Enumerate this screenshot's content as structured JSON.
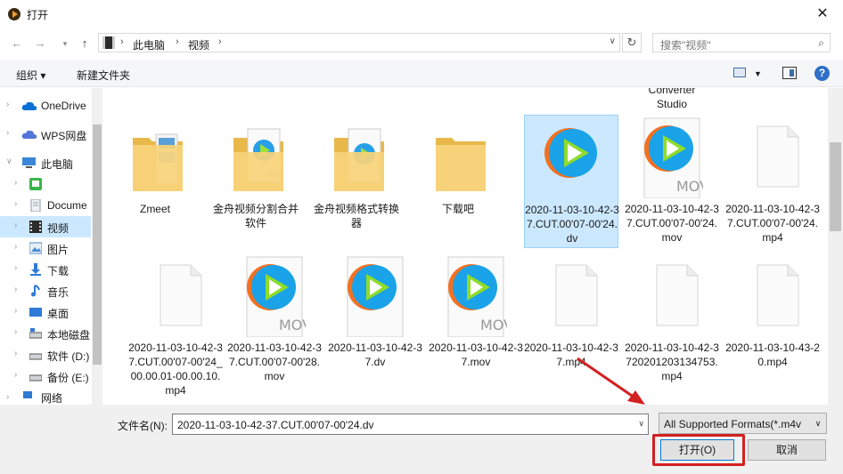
{
  "window": {
    "title": "打开",
    "close_glyph": "✕"
  },
  "address": {
    "crumbs": [
      "此电脑",
      "视频"
    ],
    "search_placeholder": "搜索\"视频\""
  },
  "toolbar": {
    "organize_label": "组织 ▾",
    "new_folder_label": "新建文件夹"
  },
  "sidebar": {
    "items": [
      {
        "label": "OneDrive",
        "icon": "cloud-icon",
        "color": "#0a6fd4"
      },
      {
        "label": "WPS网盘",
        "icon": "cloud-icon",
        "color": "#5277d8"
      },
      {
        "label": "此电脑",
        "icon": "computer-icon",
        "color": "#3b87d6"
      },
      {
        "label": "",
        "icon": "app-icon",
        "color": "#3bb54a"
      },
      {
        "label": "Docume",
        "icon": "document-icon",
        "color": "#8e9aa8"
      },
      {
        "label": "视频",
        "icon": "video-icon",
        "color": "#2b2b2b"
      },
      {
        "label": "图片",
        "icon": "picture-icon",
        "color": "#4a8bd0"
      },
      {
        "label": "下载",
        "icon": "download-icon",
        "color": "#2d7ad6"
      },
      {
        "label": "音乐",
        "icon": "music-icon",
        "color": "#2d7ad6"
      },
      {
        "label": "桌面",
        "icon": "desktop-icon",
        "color": "#2d7ad6"
      },
      {
        "label": "本地磁盘",
        "icon": "drive-icon",
        "color": "#555555"
      },
      {
        "label": "软件 (D:)",
        "icon": "drive-icon",
        "color": "#555555"
      },
      {
        "label": "备份 (E:)",
        "icon": "drive-icon",
        "color": "#555555"
      },
      {
        "label": "网络",
        "icon": "network-icon",
        "color": "#2d7ad6"
      }
    ]
  },
  "files": {
    "partial_label": "Converter Studio",
    "items": [
      {
        "label": "Zmeet",
        "kind": "folder"
      },
      {
        "label": "金舟视频分割合并软件",
        "kind": "folder-mp4"
      },
      {
        "label": "金舟视频格式转换器",
        "kind": "folder-video"
      },
      {
        "label": "下载吧",
        "kind": "folder"
      },
      {
        "label": "2020-11-03-10-42-37.CUT.00'07-00'24.dv",
        "kind": "video"
      },
      {
        "label": "2020-11-03-10-42-37.CUT.00'07-00'24.mov",
        "kind": "video-mov"
      },
      {
        "label": "2020-11-03-10-42-37.CUT.00'07-00'24.mp4",
        "kind": "doc"
      },
      {
        "label": "2020-11-03-10-42-37.CUT.00'07-00'24_00.00.01-00.00.10.mp4",
        "kind": "doc"
      },
      {
        "label": "2020-11-03-10-42-37.CUT.00'07-00'28.mov",
        "kind": "video-mov"
      },
      {
        "label": "2020-11-03-10-42-37.dv",
        "kind": "video"
      },
      {
        "label": "2020-11-03-10-42-37.mov",
        "kind": "video-mov"
      },
      {
        "label": "2020-11-03-10-42-37.mp4",
        "kind": "doc"
      },
      {
        "label": "2020-11-03-10-42-3720201203134753.mp4",
        "kind": "doc"
      },
      {
        "label": "2020-11-03-10-43-20.mp4",
        "kind": "doc"
      }
    ]
  },
  "bottom": {
    "filename_label": "文件名(N):",
    "filename_value": "2020-11-03-10-42-37.CUT.00'07-00'24.dv",
    "filter_value": "All Supported Formats(*.m4v",
    "open_label": "打开(O)",
    "cancel_label": "取消"
  },
  "colors": {
    "selection": "#cce8ff",
    "accent": "#0078d7",
    "highlight": "#d32020"
  }
}
